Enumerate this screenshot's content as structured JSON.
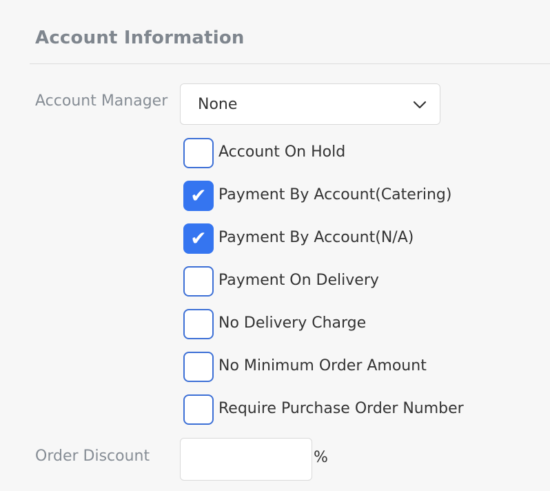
{
  "section": {
    "title": "Account Information"
  },
  "account_manager": {
    "label": "Account Manager",
    "selected": "None",
    "icon": "chevron-down-icon"
  },
  "options": [
    {
      "label": "Account On Hold",
      "checked": false
    },
    {
      "label": "Payment By Account(Catering)",
      "checked": true
    },
    {
      "label": "Payment By Account(N/A)",
      "checked": true
    },
    {
      "label": "Payment On Delivery",
      "checked": false
    },
    {
      "label": "No Delivery Charge",
      "checked": false
    },
    {
      "label": "No Minimum Order Amount",
      "checked": false
    },
    {
      "label": "Require Purchase Order Number",
      "checked": false
    }
  ],
  "order_discount": {
    "label": "Order Discount",
    "value": "",
    "unit": "%"
  },
  "colors": {
    "checkbox_checked": "#3575f0",
    "checkbox_border": "#3c6fd6",
    "label_gray": "#868d95"
  }
}
